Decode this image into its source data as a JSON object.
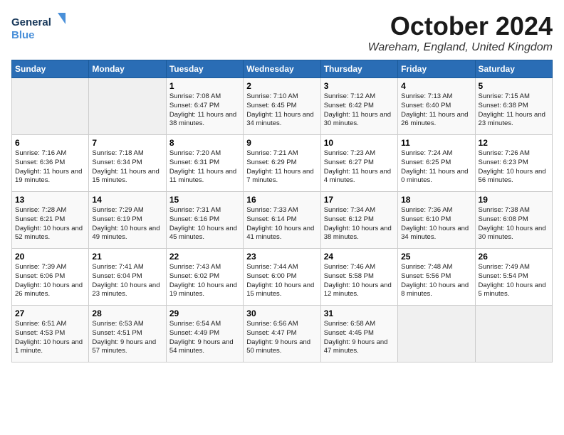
{
  "logo": {
    "line1": "General",
    "line2": "Blue"
  },
  "title": "October 2024",
  "subtitle": "Wareham, England, United Kingdom",
  "days_of_week": [
    "Sunday",
    "Monday",
    "Tuesday",
    "Wednesday",
    "Thursday",
    "Friday",
    "Saturday"
  ],
  "weeks": [
    [
      {
        "day": "",
        "detail": ""
      },
      {
        "day": "",
        "detail": ""
      },
      {
        "day": "1",
        "detail": "Sunrise: 7:08 AM\nSunset: 6:47 PM\nDaylight: 11 hours and 38 minutes."
      },
      {
        "day": "2",
        "detail": "Sunrise: 7:10 AM\nSunset: 6:45 PM\nDaylight: 11 hours and 34 minutes."
      },
      {
        "day": "3",
        "detail": "Sunrise: 7:12 AM\nSunset: 6:42 PM\nDaylight: 11 hours and 30 minutes."
      },
      {
        "day": "4",
        "detail": "Sunrise: 7:13 AM\nSunset: 6:40 PM\nDaylight: 11 hours and 26 minutes."
      },
      {
        "day": "5",
        "detail": "Sunrise: 7:15 AM\nSunset: 6:38 PM\nDaylight: 11 hours and 23 minutes."
      }
    ],
    [
      {
        "day": "6",
        "detail": "Sunrise: 7:16 AM\nSunset: 6:36 PM\nDaylight: 11 hours and 19 minutes."
      },
      {
        "day": "7",
        "detail": "Sunrise: 7:18 AM\nSunset: 6:34 PM\nDaylight: 11 hours and 15 minutes."
      },
      {
        "day": "8",
        "detail": "Sunrise: 7:20 AM\nSunset: 6:31 PM\nDaylight: 11 hours and 11 minutes."
      },
      {
        "day": "9",
        "detail": "Sunrise: 7:21 AM\nSunset: 6:29 PM\nDaylight: 11 hours and 7 minutes."
      },
      {
        "day": "10",
        "detail": "Sunrise: 7:23 AM\nSunset: 6:27 PM\nDaylight: 11 hours and 4 minutes."
      },
      {
        "day": "11",
        "detail": "Sunrise: 7:24 AM\nSunset: 6:25 PM\nDaylight: 11 hours and 0 minutes."
      },
      {
        "day": "12",
        "detail": "Sunrise: 7:26 AM\nSunset: 6:23 PM\nDaylight: 10 hours and 56 minutes."
      }
    ],
    [
      {
        "day": "13",
        "detail": "Sunrise: 7:28 AM\nSunset: 6:21 PM\nDaylight: 10 hours and 52 minutes."
      },
      {
        "day": "14",
        "detail": "Sunrise: 7:29 AM\nSunset: 6:19 PM\nDaylight: 10 hours and 49 minutes."
      },
      {
        "day": "15",
        "detail": "Sunrise: 7:31 AM\nSunset: 6:16 PM\nDaylight: 10 hours and 45 minutes."
      },
      {
        "day": "16",
        "detail": "Sunrise: 7:33 AM\nSunset: 6:14 PM\nDaylight: 10 hours and 41 minutes."
      },
      {
        "day": "17",
        "detail": "Sunrise: 7:34 AM\nSunset: 6:12 PM\nDaylight: 10 hours and 38 minutes."
      },
      {
        "day": "18",
        "detail": "Sunrise: 7:36 AM\nSunset: 6:10 PM\nDaylight: 10 hours and 34 minutes."
      },
      {
        "day": "19",
        "detail": "Sunrise: 7:38 AM\nSunset: 6:08 PM\nDaylight: 10 hours and 30 minutes."
      }
    ],
    [
      {
        "day": "20",
        "detail": "Sunrise: 7:39 AM\nSunset: 6:06 PM\nDaylight: 10 hours and 26 minutes."
      },
      {
        "day": "21",
        "detail": "Sunrise: 7:41 AM\nSunset: 6:04 PM\nDaylight: 10 hours and 23 minutes."
      },
      {
        "day": "22",
        "detail": "Sunrise: 7:43 AM\nSunset: 6:02 PM\nDaylight: 10 hours and 19 minutes."
      },
      {
        "day": "23",
        "detail": "Sunrise: 7:44 AM\nSunset: 6:00 PM\nDaylight: 10 hours and 15 minutes."
      },
      {
        "day": "24",
        "detail": "Sunrise: 7:46 AM\nSunset: 5:58 PM\nDaylight: 10 hours and 12 minutes."
      },
      {
        "day": "25",
        "detail": "Sunrise: 7:48 AM\nSunset: 5:56 PM\nDaylight: 10 hours and 8 minutes."
      },
      {
        "day": "26",
        "detail": "Sunrise: 7:49 AM\nSunset: 5:54 PM\nDaylight: 10 hours and 5 minutes."
      }
    ],
    [
      {
        "day": "27",
        "detail": "Sunrise: 6:51 AM\nSunset: 4:53 PM\nDaylight: 10 hours and 1 minute."
      },
      {
        "day": "28",
        "detail": "Sunrise: 6:53 AM\nSunset: 4:51 PM\nDaylight: 9 hours and 57 minutes."
      },
      {
        "day": "29",
        "detail": "Sunrise: 6:54 AM\nSunset: 4:49 PM\nDaylight: 9 hours and 54 minutes."
      },
      {
        "day": "30",
        "detail": "Sunrise: 6:56 AM\nSunset: 4:47 PM\nDaylight: 9 hours and 50 minutes."
      },
      {
        "day": "31",
        "detail": "Sunrise: 6:58 AM\nSunset: 4:45 PM\nDaylight: 9 hours and 47 minutes."
      },
      {
        "day": "",
        "detail": ""
      },
      {
        "day": "",
        "detail": ""
      }
    ]
  ]
}
